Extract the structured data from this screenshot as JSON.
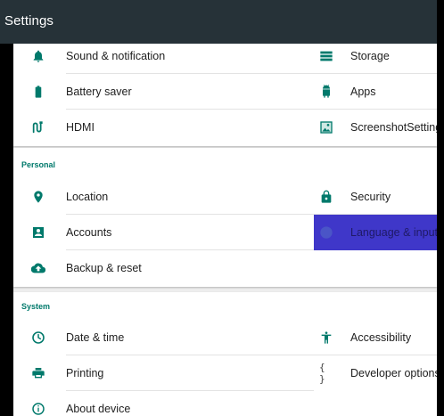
{
  "header": {
    "title": "Settings"
  },
  "sections": {
    "device": {
      "left": [
        {
          "label": "Sound & notification",
          "icon": "bell-icon"
        },
        {
          "label": "Battery saver",
          "icon": "battery-icon"
        },
        {
          "label": "HDMI",
          "icon": "hdmi-icon"
        }
      ],
      "right": [
        {
          "label": "Storage",
          "icon": "storage-icon"
        },
        {
          "label": "Apps",
          "icon": "android-icon"
        },
        {
          "label": "ScreenshotSetting",
          "icon": "screenshot-icon"
        }
      ]
    },
    "personal": {
      "title": "Personal",
      "left": [
        {
          "label": "Location",
          "icon": "location-pin-icon"
        },
        {
          "label": "Accounts",
          "icon": "account-box-icon"
        },
        {
          "label": "Backup & reset",
          "icon": "cloud-upload-icon"
        }
      ],
      "right": [
        {
          "label": "Security",
          "icon": "lock-icon"
        },
        {
          "label": "Language & input",
          "icon": "globe-icon",
          "selected": true
        }
      ]
    },
    "system": {
      "title": "System",
      "left": [
        {
          "label": "Date & time",
          "icon": "clock-icon"
        },
        {
          "label": "Printing",
          "icon": "printer-icon"
        },
        {
          "label": "About device",
          "icon": "info-icon"
        }
      ],
      "right": [
        {
          "label": "Accessibility",
          "icon": "accessibility-icon"
        },
        {
          "label": "Developer options",
          "icon": "code-braces-icon"
        }
      ]
    }
  },
  "colors": {
    "appbar": "#263238",
    "icon": "#00796b",
    "category": "#00796b",
    "selected": "#3f37c9"
  }
}
